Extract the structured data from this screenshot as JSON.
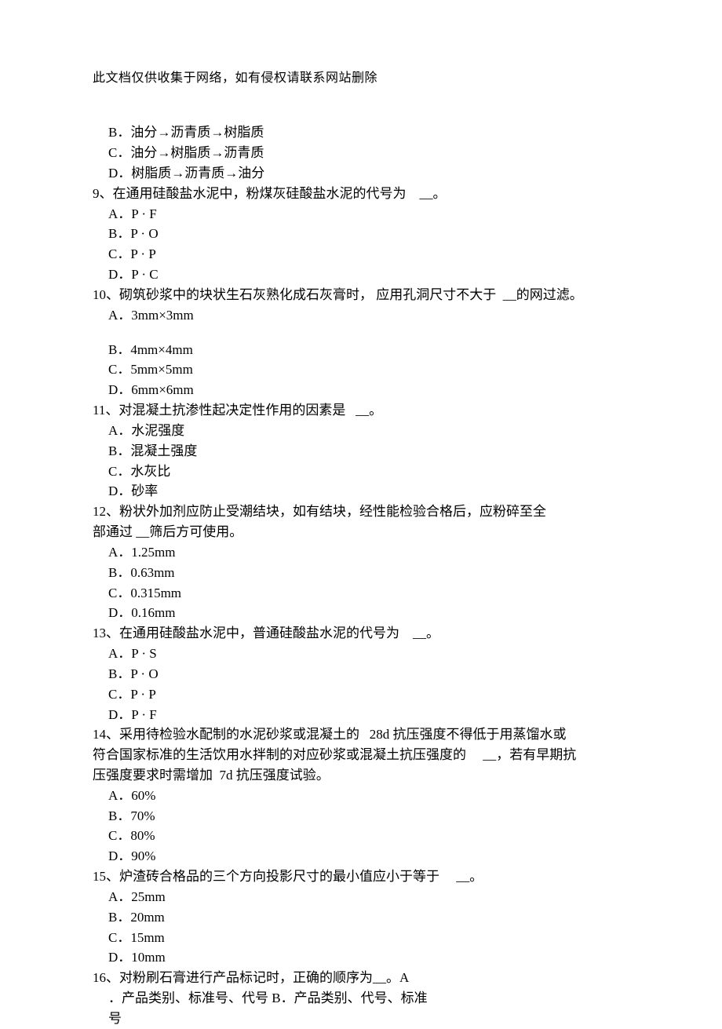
{
  "headerNote": "此文档仅供收集于网络，如有侵权请联系网站删除",
  "lines": {
    "l1": "B．油分→沥青质→树脂质",
    "l2": "C．油分→树脂质→沥青质",
    "l3": "D．树脂质→沥青质→油分",
    "q9_a": "9、在通用硅酸盐水泥中，粉煤灰硅酸盐水泥的代号为",
    "q9_b": "__。",
    "q9o1": "A．P · F",
    "q9o2": "B．P · O",
    "q9o3": "C．P · P",
    "q9o4": "D．P · C",
    "q10_a": "10、砌筑砂浆中的块状生石灰熟化成石灰膏时， 应用孔洞尺寸不大于",
    "q10_b": "__的网过滤。",
    "q10o1": "A．3mm×3mm",
    "q10o2": "B．4mm×4mm",
    "q10o3": "C．5mm×5mm",
    "q10o4": "D．6mm×6mm",
    "q11_a": "11、对混凝土抗渗性起决定性作用的因素是",
    "q11_b": "__。",
    "q11o1": "A．水泥强度",
    "q11o2": "B．混凝土强度",
    "q11o3": "C．水灰比",
    "q11o4": "D．砂率",
    "q12a": "12、粉状外加剂应防止受潮结块，如有结块，经性能检验合格后，应粉碎至全",
    "q12b": "部通过 __筛后方可使用。",
    "q12o1": "A．1.25mm",
    "q12o2": "B．0.63mm",
    "q12o3": "C．0.315mm",
    "q12o4": "D．0.16mm",
    "q13_a": "13、在通用硅酸盐水泥中，普通硅酸盐水泥的代号为",
    "q13_b": "__。",
    "q13o1": "A．P · S",
    "q13o2": "B．P · O",
    "q13o3": "C．P · P",
    "q13o4": "D．P · F",
    "q14a_a": "14、采用待检验水配制的水泥砂浆或混凝土的",
    "q14a_b": "28d 抗压强度不得低于用蒸馏水或",
    "q14b_a": "符合国家标准的生活饮用水拌制的对应砂浆或混凝土抗压强度的",
    "q14b_b": "__，若有早期抗",
    "q14c_a": "压强度要求时需增加",
    "q14c_b": "7d 抗压强度试验。",
    "q14o1": "A．60%",
    "q14o2": "B．70%",
    "q14o3": "C．80%",
    "q14o4": "D．90%",
    "q15_a": "15、炉渣砖合格品的三个方向投影尺寸的最小值应小于等于",
    "q15_b": "__。",
    "q15o1": "A．25mm",
    "q15o2": "B．20mm",
    "q15o3": "C．15mm",
    "q15o4": "D．10mm",
    "q16a": "16、对粉刷石膏进行产品标记时，正确的顺序为__。A",
    "q16b": "．产品类别、标准号、代号 B．产品类别、代号、标准",
    "q16c": "号"
  }
}
